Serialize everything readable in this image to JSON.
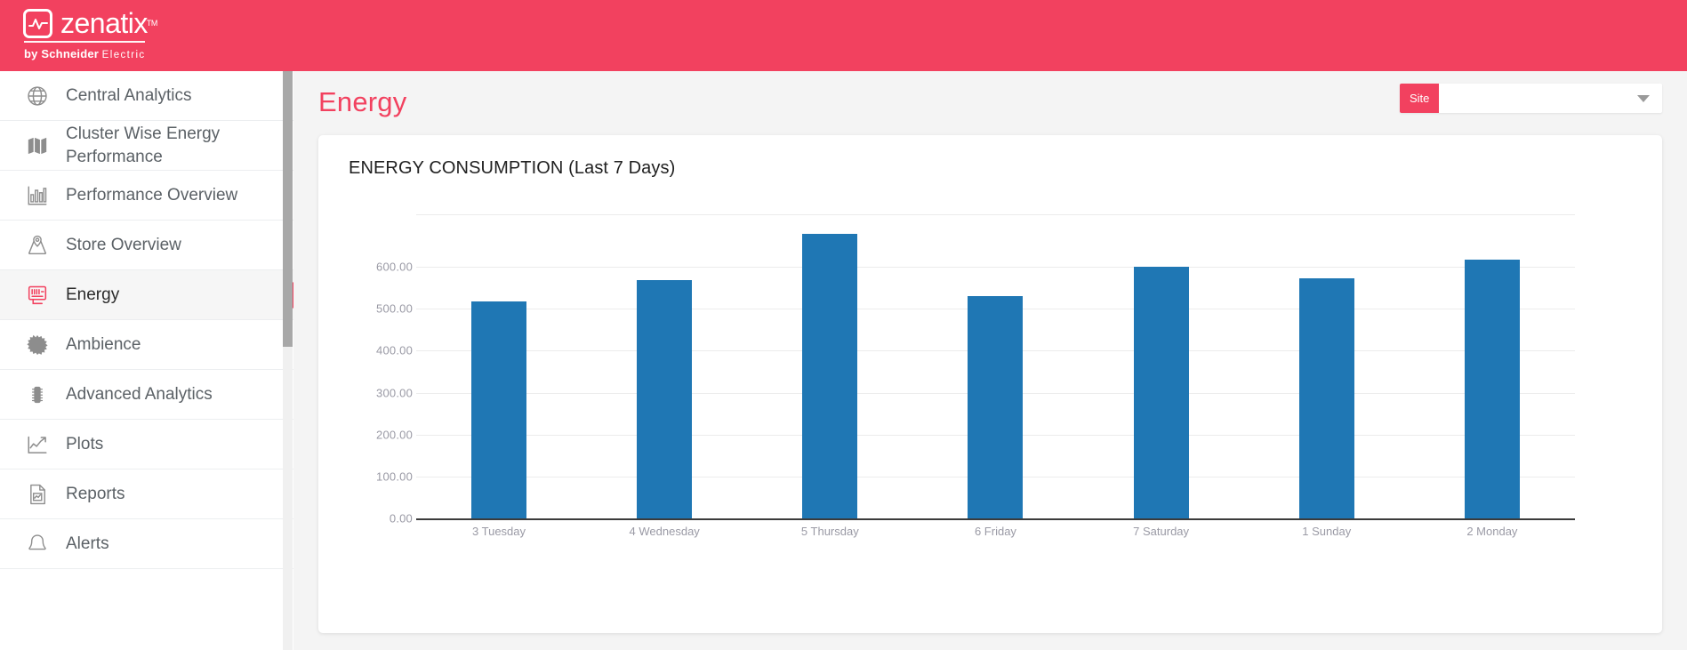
{
  "brand": {
    "name": "zenatix",
    "tm": "TM",
    "sub_bold": "by Schneider",
    "sub_light": "Electric",
    "bar_color": "#f2415f"
  },
  "sidebar": {
    "items": [
      {
        "label": "Central Analytics",
        "icon": "globe-icon",
        "active": false
      },
      {
        "label": "Cluster Wise Energy Performance",
        "icon": "map-icon",
        "active": false
      },
      {
        "label": "Performance Overview",
        "icon": "bar-chart-icon",
        "active": false
      },
      {
        "label": "Store Overview",
        "icon": "store-pin-icon",
        "active": false
      },
      {
        "label": "Energy",
        "icon": "energy-meter-icon",
        "active": true
      },
      {
        "label": "Ambience",
        "icon": "sun-burst-icon",
        "active": false
      },
      {
        "label": "Advanced Analytics",
        "icon": "chip-icon",
        "active": false
      },
      {
        "label": "Plots",
        "icon": "trend-line-icon",
        "active": false
      },
      {
        "label": "Reports",
        "icon": "report-doc-icon",
        "active": false
      },
      {
        "label": "Alerts",
        "icon": "bell-icon",
        "active": false
      }
    ]
  },
  "page": {
    "title": "Energy",
    "title_color": "#f2415f"
  },
  "site_select": {
    "badge": "Site",
    "value": "",
    "placeholder": "",
    "caret_icon": "chevron-down-icon"
  },
  "chart_data": {
    "type": "bar",
    "title": "ENERGY CONSUMPTION (Last 7 Days)",
    "categories": [
      "3 Tuesday",
      "4 Wednesday",
      "5 Thursday",
      "6 Friday",
      "7 Saturday",
      "1 Sunday",
      "2 Monday"
    ],
    "values": [
      517,
      569,
      679,
      531,
      600,
      572,
      617
    ],
    "series": [
      {
        "name": "Energy Consumption",
        "values": [
          517,
          569,
          679,
          531,
          600,
          572,
          617
        ],
        "color": "#1f77b4"
      }
    ],
    "yticks": [
      "0.00",
      "100.00",
      "200.00",
      "300.00",
      "400.00",
      "500.00",
      "600.00"
    ],
    "ytick_values": [
      0,
      100,
      200,
      300,
      400,
      500,
      600
    ],
    "ylim": [
      0,
      700
    ],
    "xlabel": "",
    "ylabel": "",
    "grid": true,
    "legend": false,
    "bar_color": "#1f77b4"
  }
}
